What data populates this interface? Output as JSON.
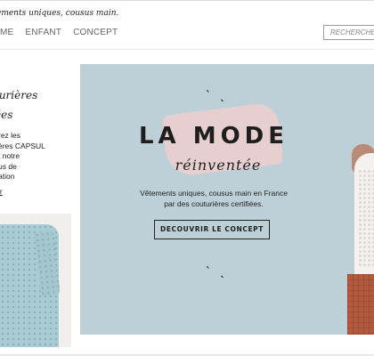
{
  "header": {
    "tagline": "ements uniques, cousus main.",
    "nav": [
      "ME",
      "ENFANT",
      "CONCEPT"
    ],
    "search_placeholder": "RECHERCHE"
  },
  "sidebar": {
    "title_lines": [
      "turières",
      "ées"
    ],
    "text_lines": [
      "rez les",
      "ères CAPSUL",
      "t notre",
      "us de",
      "ation"
    ],
    "link": "ir"
  },
  "hero": {
    "quote_mark": "ˋ ˎ",
    "title": "LA MODE",
    "script": "réinventée",
    "subtitle_lines": [
      "Vêtements uniques, cousus main en France",
      "par des couturières certifiées."
    ],
    "cta": "DECOUVRIR LE CONCEPT",
    "colors": {
      "background": "#bed0d7",
      "brush": "#e8cfcd"
    }
  }
}
